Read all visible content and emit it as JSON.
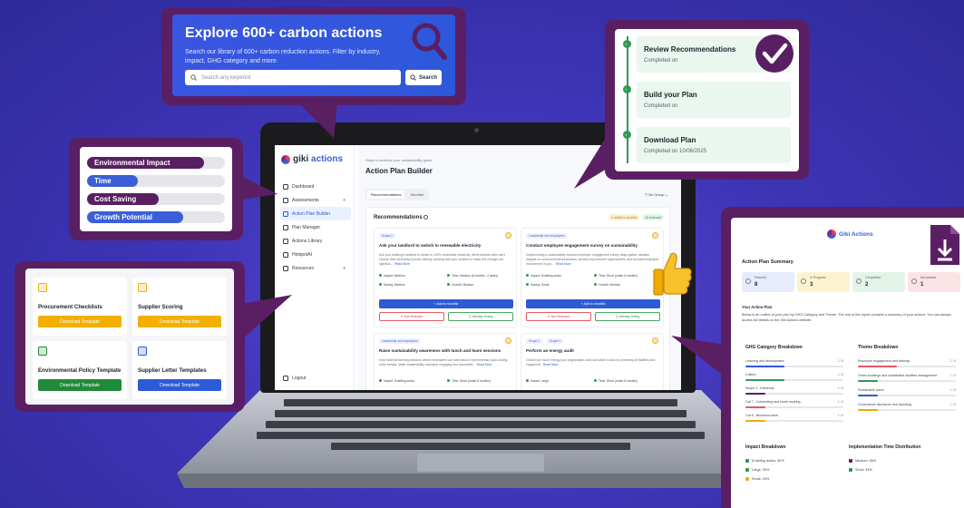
{
  "search": {
    "title": "Explore 600+ carbon actions",
    "subtitle": "Search our library of 600+ carbon reduction actions. Filter by industry, impact, GHG category and more.",
    "placeholder": "Search any keyword",
    "button": "Search",
    "icon": "magnifier-icon",
    "accent": "#5a1f63"
  },
  "bars": [
    {
      "label": "Environmental Impact",
      "fill": 0.85,
      "color": "#5a1f63"
    },
    {
      "label": "Time",
      "fill": 0.37,
      "color": "#3a5fd9"
    },
    {
      "label": "Cost Saving",
      "fill": 0.52,
      "color": "#5a1f63"
    },
    {
      "label": "Growth Potential",
      "fill": 0.7,
      "color": "#3a5fd9"
    }
  ],
  "templates": [
    {
      "title": "Procurement Checklists",
      "button": "Download Template",
      "color": "#f2b000",
      "icon": "clipboard-icon"
    },
    {
      "title": "Supplier Scoring",
      "button": "Download Template",
      "color": "#f2b000",
      "icon": "clipboard-icon"
    },
    {
      "title": "Environmental Policy Template",
      "button": "Download Template",
      "color": "#1f8a3a",
      "icon": "document-icon"
    },
    {
      "title": "Supplier Letter Templates",
      "button": "Download Template",
      "color": "#2d5ad6",
      "icon": "mail-icon"
    }
  ],
  "steps": [
    {
      "title": "Review Recommendations",
      "sub": "Completed on"
    },
    {
      "title": "Build your Plan",
      "sub": "Completed on"
    },
    {
      "title": "Download Plan",
      "sub": "Completed on 10/06/2025"
    }
  ],
  "app": {
    "logo_pre": "giki",
    "logo_post": "actions",
    "nav": [
      {
        "label": "Dashboard",
        "icon": "grid-icon"
      },
      {
        "label": "Assessments",
        "icon": "clipboard-icon",
        "chevron": "+"
      },
      {
        "label": "Action Plan Builder",
        "icon": "target-icon",
        "active": true
      },
      {
        "label": "Plan Manager",
        "icon": "sliders-icon"
      },
      {
        "label": "Actions Library",
        "icon": "library-icon"
      },
      {
        "label": "HotspotAI",
        "icon": "sparkle-icon"
      },
      {
        "label": "Resources",
        "icon": "folder-icon",
        "chevron": "+"
      }
    ],
    "logout": "Logout",
    "step_text": "Steps to achieve your sustainability goals",
    "page_title": "Action Plan Builder",
    "tabs": [
      "Recommendations",
      "Shortlist"
    ],
    "group": "No Group",
    "rec_title": "Recommendations",
    "badge_added": "0 added to shortlist",
    "badge_reviewed": "16 reviewed",
    "cards": [
      {
        "tag": "Scope 2",
        "title": "Ask your landlord to switch to renewable electricity",
        "desc": "Ask your building's landlord to switch to 100% renewable electricity. While tenants often can't choose their electricity provider directly, working with your landlord to make this change can significa...",
        "read_more": "Read More",
        "m1": "Impact: Medium",
        "m2": "Time: Medium (6 months - 2 years)",
        "m3": "Saving: Medium",
        "m4": "Growth: Medium"
      },
      {
        "tag": "Leadership and employees",
        "title": "Conduct employee engagement survey on sustainability",
        "desc": "Implementing a sustainability-focused employee engagement survey helps gather valuable insights on environmental awareness, identify improvement opportunities, and increase employee involvement in you...",
        "read_more": "Read More",
        "m1": "Impact: Enabling action",
        "m2": "Time: Short (under 6 months)",
        "m3": "Saving: Small",
        "m4": "Growth: Medium"
      },
      {
        "tag": "Leadership and employees",
        "title": "Raise sustainability awareness with lunch and learn sessions",
        "desc": "Host informal learning sessions where employees can learn about environmental topics during lunch breaks. Make sustainability education engaging and accessible -",
        "read_more": "Read More",
        "m1": "Impact: Enabling action",
        "m2": "Time: Short (under 6 months)"
      },
      {
        "tag": "Scope 2",
        "tag2": "Scope 3",
        "title": "Perform an energy audit",
        "desc": "Check how much energy your organization uses and what it costs by reviewing all facilities and equipment.",
        "read_more": "Read More",
        "m1": "Impact: Large",
        "m2": "Time: Short (under 6 months)"
      }
    ],
    "add": "+ Add to shortlist",
    "not_relevant": "✕ Not Relevant",
    "already_doing": "◎ Already Doing"
  },
  "summary": {
    "logo": "Giki Actions",
    "heading": "Action Plan Summary",
    "stats": [
      {
        "label": "Planned",
        "value": "8",
        "color": "#e6ecfb"
      },
      {
        "label": "In Progress",
        "value": "3",
        "color": "#fbf2cf"
      },
      {
        "label": "Completed",
        "value": "2",
        "color": "#e2f5e8"
      },
      {
        "label": "Not started",
        "value": "1",
        "color": "#fbe3e5"
      }
    ],
    "plan_title": "Your Action Plan",
    "plan_text": "Below is an outline of your plan by GHG Category and Theme. The rest of the report contains a summary of your actions. You can always access full details on the Giki Actions website.",
    "ghg_h": "GHG Category Breakdown",
    "ghg": [
      {
        "label": "Learning and development",
        "n": "2 / 8",
        "fill": 0.4,
        "color": "#2d5ad6"
      },
      {
        "label": "Culture",
        "n": "2 / 8",
        "fill": 0.4,
        "color": "#2f9a55"
      },
      {
        "label": "Scope 2 - Electricity",
        "n": "1 / 8",
        "fill": 0.2,
        "color": "#5a1f63"
      },
      {
        "label": "Cat 7 - Commuting and home working",
        "n": "1 / 8",
        "fill": 0.2,
        "color": "#e05a67"
      },
      {
        "label": "Cat 6 - Business travel",
        "n": "1 / 8",
        "fill": 0.2,
        "color": "#f2a900"
      }
    ],
    "theme_h": "Theme Breakdown",
    "theme": [
      {
        "label": "Employee engagement and training",
        "n": "2 / 8",
        "fill": 0.4,
        "color": "#e05a67"
      },
      {
        "label": "Green buildings and sustainable facilities management",
        "n": "1 / 8",
        "fill": 0.2,
        "color": "#2f9a55"
      },
      {
        "label": "Sustainable travel",
        "n": "1 / 8",
        "fill": 0.2,
        "color": "#2d5ad6"
      },
      {
        "label": "Governance disclosure and reporting",
        "n": "1 / 8",
        "fill": 0.2,
        "color": "#f2a900"
      }
    ],
    "impact_h": "Impact Breakdown",
    "impact": [
      "Enabling action: 50%",
      "Large: 33%",
      "Small: 16%"
    ],
    "time_h": "Implementation Time Distribution",
    "time": [
      "Medium: 66%",
      "Short: 33%"
    ]
  }
}
